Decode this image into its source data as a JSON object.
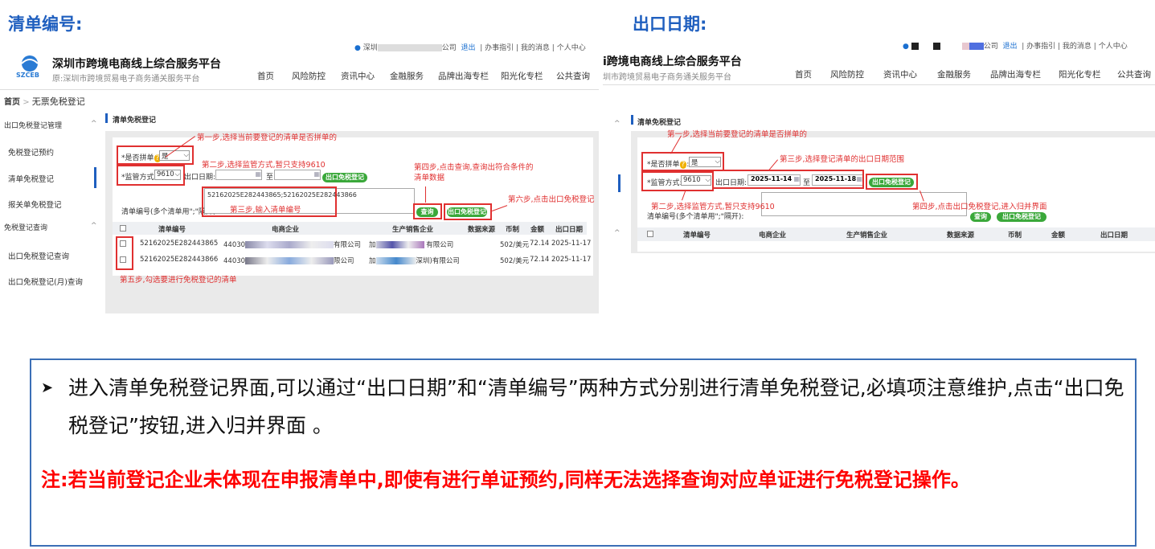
{
  "headings": {
    "left": "清单编号:",
    "right": "出口日期:"
  },
  "top_links": {
    "company_prefix": "深圳",
    "company_suffix": "公司",
    "logout": "退出",
    "guide": "办事指引",
    "messages": "我的消息",
    "personal": "个人中心"
  },
  "site": {
    "title_left": "深圳市跨境电商线上综合服务平台",
    "title_right": "i跨境电商线上综合服务平台",
    "sub_left": "原:深圳市跨境贸易电子商务通关服务平台",
    "sub_right": "圳市跨境贸易电子商务通关服务平台",
    "logo_text": "SZCEB"
  },
  "nav": [
    "首页",
    "风险防控",
    "资讯中心",
    "金融服务",
    "品牌出海专栏",
    "阳光化专栏",
    "公共查询"
  ],
  "breadcrumb": {
    "home": "首页",
    "sep": ">",
    "current": "无票免税登记"
  },
  "sidebar": {
    "group1": "出口免税登记管理",
    "items1": [
      "免税登记预约",
      "清单免税登记",
      "报关单免税登记"
    ],
    "group2": "免税登记查询",
    "items2": [
      "出口免税登记查询",
      "出口免税登记(月)查询"
    ]
  },
  "form": {
    "section_title": "清单免税登记",
    "merge_label": "*是否拼单",
    "merge_value": "是",
    "mode_label": "*监管方式:",
    "mode_value": "9610",
    "date_label": "出口日期:",
    "date_to": "至",
    "date_from_value": "2025-11-14",
    "date_to_value": "2025-11-18",
    "list_label": "清单编号(多个清单用\";\"隔开):",
    "list_value": "52162025E282443865;52162025E282443866",
    "query_btn": "查询",
    "register_btn": "出口免税登记"
  },
  "table": {
    "headers": [
      "清单编号",
      "电商企业",
      "生产销售企业",
      "数据来源",
      "币制",
      "金额",
      "出口日期"
    ],
    "rows": [
      {
        "id": "52162025E282443865",
        "ecom_prefix": "44030",
        "ecom_suffix": "有限公司",
        "prod_prefix": "加",
        "prod_suffix": "有限公司",
        "currency": "502/美元",
        "amount": "72.14",
        "date": "2025-11-17"
      },
      {
        "id": "52162025E282443866",
        "ecom_prefix": "44030",
        "ecom_suffix": "限公司",
        "prod_prefix": "加",
        "prod_suffix": "深圳)有限公司",
        "currency": "502/美元",
        "amount": "72.14",
        "date": "2025-11-17"
      }
    ]
  },
  "annotations_left": {
    "step1": "第一步,选择当前要登记的清单是否拼单的",
    "step2": "第二步,选择监管方式,暂只支持9610",
    "step3": "第三步,输入清单编号",
    "step4": "第四步,点击查询,查询出符合条件的清单数据",
    "step5": "第五步,勾选要进行免税登记的清单",
    "step6": "第六步,点击出口免税登记"
  },
  "annotations_right": {
    "step1": "第一步,选择当前要登记的清单是否拼单的",
    "step2": "第二步,选择监管方式,暂只支持9610",
    "step3": "第三步,选择登记清单的出口日期范围",
    "step4": "第四步,点击出口免税登记,进入归并界面"
  },
  "info": {
    "line": "进入清单免税登记界面,可以通过“出口日期”和“清单编号”两种方式分别进行清单免税登记,必填项注意维护,点击“出口免税登记”按钮,进入归并界面 。",
    "note": "注:若当前登记企业未体现在申报清单中,即使有进行单证预约,同样无法选择查询对应单证进行免税登记操作。"
  },
  "colors": {
    "accent": "#1f5fbf",
    "annotation": "#e03030",
    "button": "#3aa83a"
  }
}
